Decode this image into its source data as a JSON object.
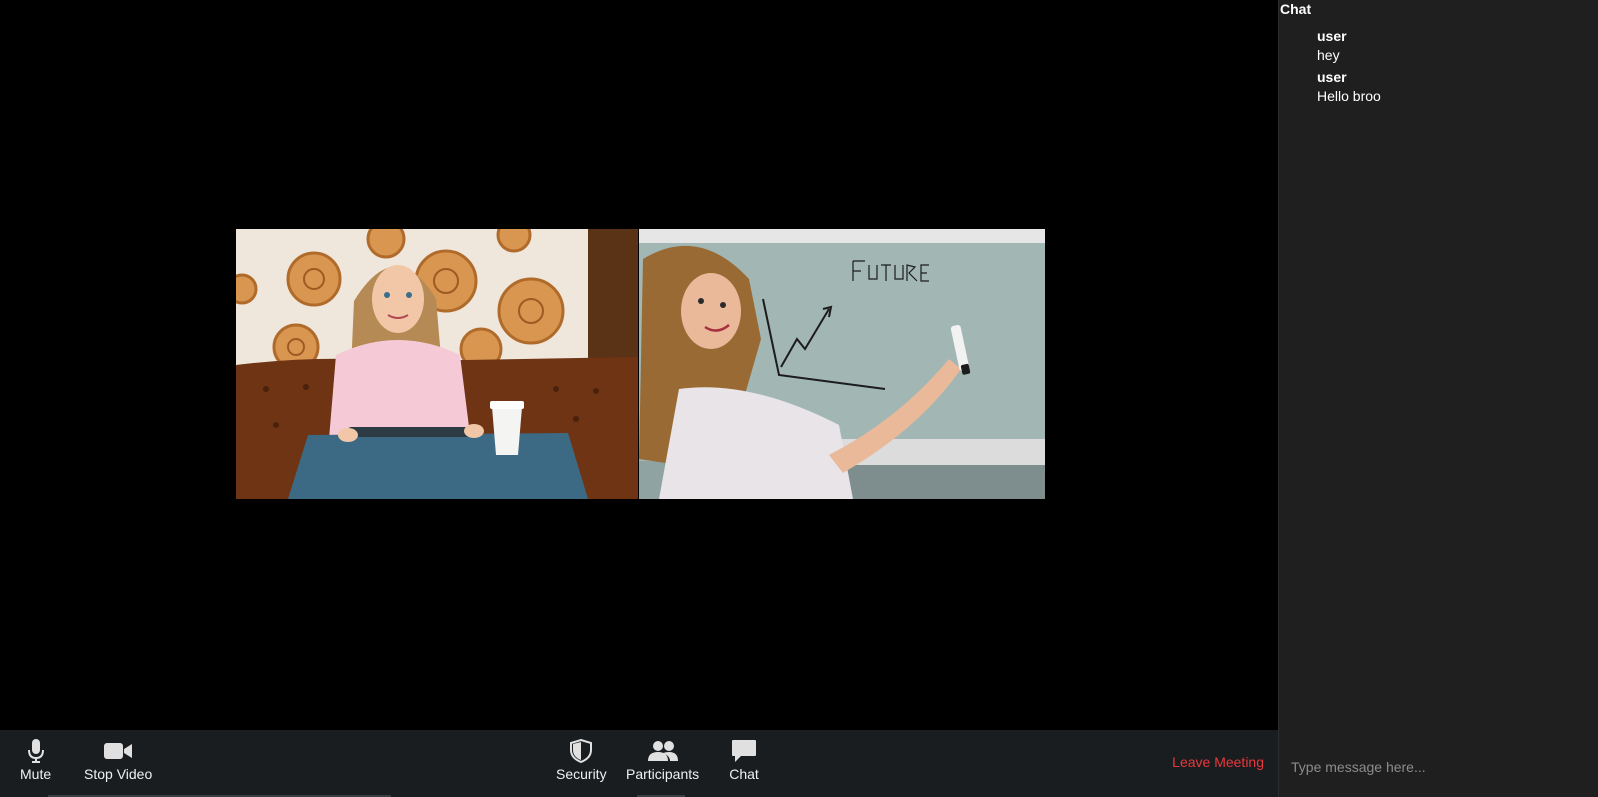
{
  "toolbar": {
    "mute_label": "Mute",
    "stop_video_label": "Stop Video",
    "security_label": "Security",
    "participants_label": "Participants",
    "chat_label": "Chat",
    "leave_label": "Leave Meeting"
  },
  "chat": {
    "title": "Chat",
    "messages": [
      {
        "sender": "user",
        "text": "hey"
      },
      {
        "sender": "user",
        "text": "Hello broo"
      }
    ],
    "input_placeholder": "Type message here..."
  },
  "icons": {
    "mute": "microphone-icon",
    "stop_video": "video-camera-icon",
    "security": "shield-icon",
    "participants": "participants-icon",
    "chat": "chat-bubble-icon"
  },
  "colors": {
    "stage_bg": "#000000",
    "toolbar_bg": "#1a1d20",
    "chat_bg": "#1f1f1f",
    "leave_color": "#e8383b"
  }
}
